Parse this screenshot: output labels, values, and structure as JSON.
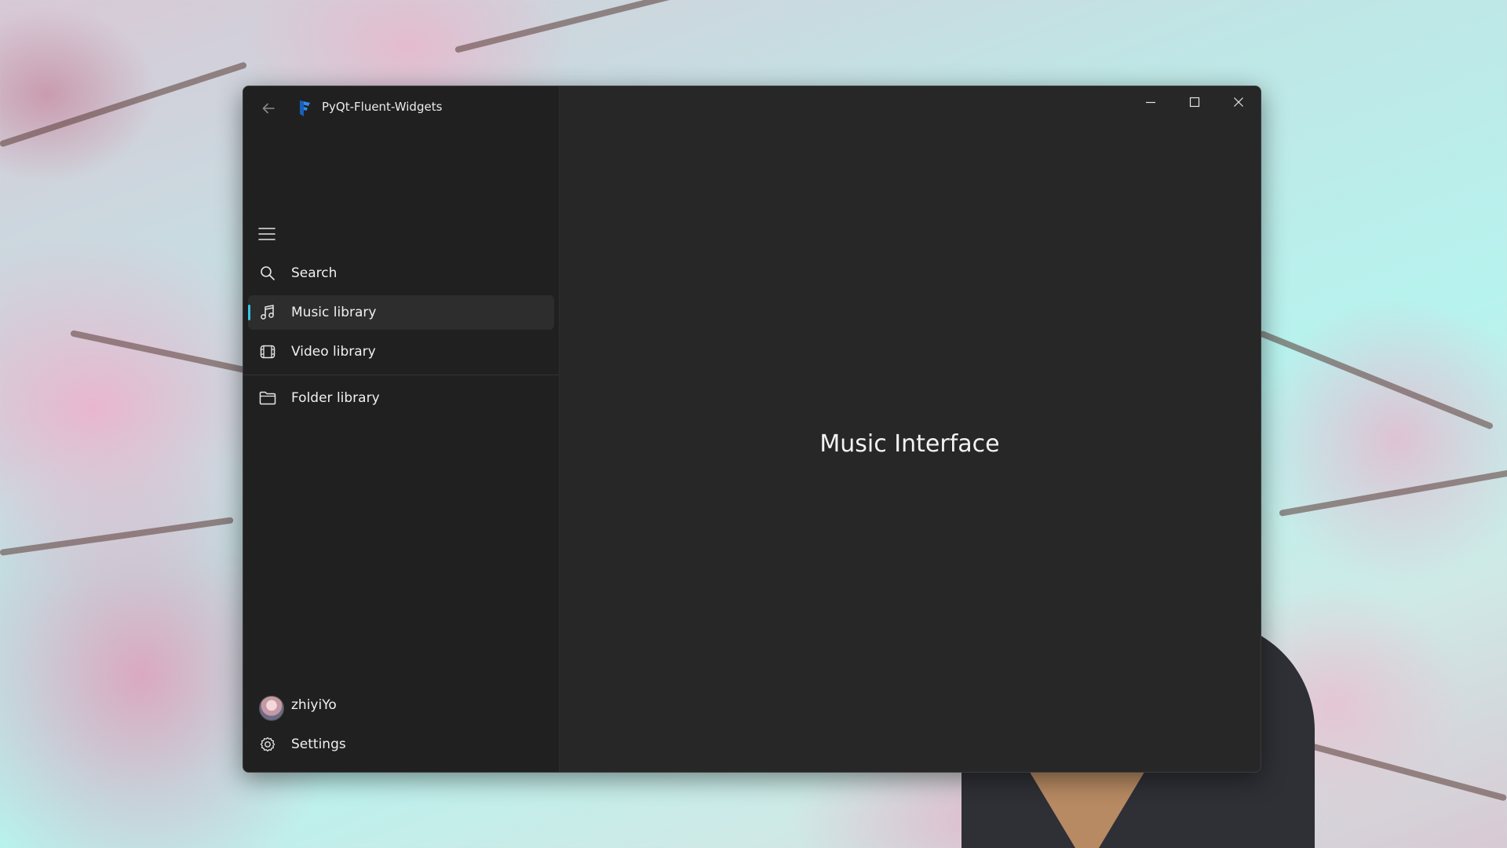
{
  "window": {
    "title": "PyQt-Fluent-Widgets",
    "controls": {
      "minimize_icon": "minimize-icon",
      "maximize_icon": "maximize-icon",
      "close_icon": "close-icon"
    }
  },
  "nav": {
    "back_icon": "back-arrow-icon",
    "menu_icon": "hamburger-menu-icon",
    "items": [
      {
        "label": "Search",
        "icon": "search-icon",
        "selected": false
      },
      {
        "label": "Music library",
        "icon": "music-note-icon",
        "selected": true
      },
      {
        "label": "Video library",
        "icon": "film-icon",
        "selected": false
      },
      {
        "label": "Folder library",
        "icon": "folder-icon",
        "selected": false
      }
    ],
    "bottom": [
      {
        "label": "zhiyiYo",
        "icon": "avatar"
      },
      {
        "label": "Settings",
        "icon": "gear-icon"
      }
    ]
  },
  "content": {
    "label": "Music Interface"
  },
  "colors": {
    "accent": "#39c4e8",
    "window_bg": "#272727",
    "nav_bg": "#202020",
    "selected_bg": "#2d2d2d",
    "text": "#f0f0f0"
  }
}
